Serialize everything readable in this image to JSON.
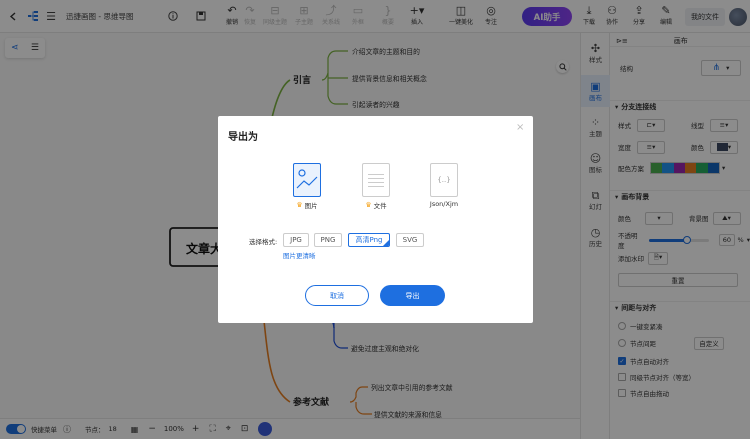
{
  "window": {
    "title": "迅捷画图 - 思维导图"
  },
  "toolbar": {
    "undo_label": "撤销",
    "redo_label": "恢复",
    "sibling_label": "同级主题",
    "child_label": "子主题",
    "relation_label": "关系线",
    "outline_label": "外框",
    "summary_label": "概要",
    "insert_label": "插入",
    "beautify_label": "一键美化",
    "focus_label": "专注",
    "ai_label": "AI助手",
    "download_label": "下载",
    "collab_label": "协作",
    "share_label": "分享",
    "edit_label": "编辑",
    "myfile_label": "我的文件"
  },
  "mindmap": {
    "root": "文章大",
    "branch1": {
      "title": "引言",
      "items": [
        "介绍文章的主题和目的",
        "提供背景信息和相关概念",
        "引起读者的兴趣"
      ],
      "color": "#7cb342"
    },
    "branch2_items": [
      "避免过度主观和绝对化"
    ],
    "branch2_color": "#1e4fd8",
    "branch3": {
      "title": "参考文献",
      "items": [
        "列出文章中引用的参考文献",
        "提供文献的来源和信息"
      ],
      "color": "#e67e22"
    }
  },
  "bottom": {
    "shortcut_label": "快捷菜单",
    "nodes_label": "节点：",
    "nodes_count": "18",
    "zoom": "100%"
  },
  "sidetabs": [
    "样式",
    "画布",
    "主题",
    "图标",
    "幻灯",
    "历史"
  ],
  "panel": {
    "header": "画布",
    "structure_label": "结构",
    "branch_section": "分支连接线",
    "style_label": "样式",
    "line_type_label": "线型",
    "width_label": "宽度",
    "color_label": "颜色",
    "scheme_label": "配色方案",
    "bg_section": "画布背景",
    "bg_color_label": "颜色",
    "bg_image_label": "背景图",
    "opacity_label": "不透明度",
    "opacity_value": "60",
    "opacity_unit": "%",
    "opacity": 0.6,
    "watermark_label": "添加水印",
    "reset_label": "重置",
    "spacing_section": "间距与对齐",
    "opt_compact": "一键变紧凑",
    "opt_spacing": "节点间距",
    "custom_label": "自定义",
    "opt_autoalign": "节点自动对齐",
    "opt_samelevel": "同级节点对齐（等宽）",
    "opt_freedrag": "节点自由拖动",
    "scheme_colors": [
      "#4caf50",
      "#2196f3",
      "#9c27b0",
      "#e67e22",
      "#27ae60",
      "#1565c0"
    ]
  },
  "modal": {
    "title": "导出为",
    "types": [
      {
        "label": "图片",
        "icon": "image-icon",
        "active": true
      },
      {
        "label": "文件",
        "icon": "document-icon",
        "active": false
      },
      {
        "label": "Json/Xjm",
        "icon": "json-icon",
        "active": false
      }
    ],
    "format_label": "选择格式:",
    "formats": [
      "JPG",
      "PNG",
      "高清Png",
      "SVG"
    ],
    "selected_format": "高清Png",
    "hint": "图片更清晰",
    "cancel_label": "取消",
    "export_label": "导出",
    "accent": "#1e6fe0"
  }
}
